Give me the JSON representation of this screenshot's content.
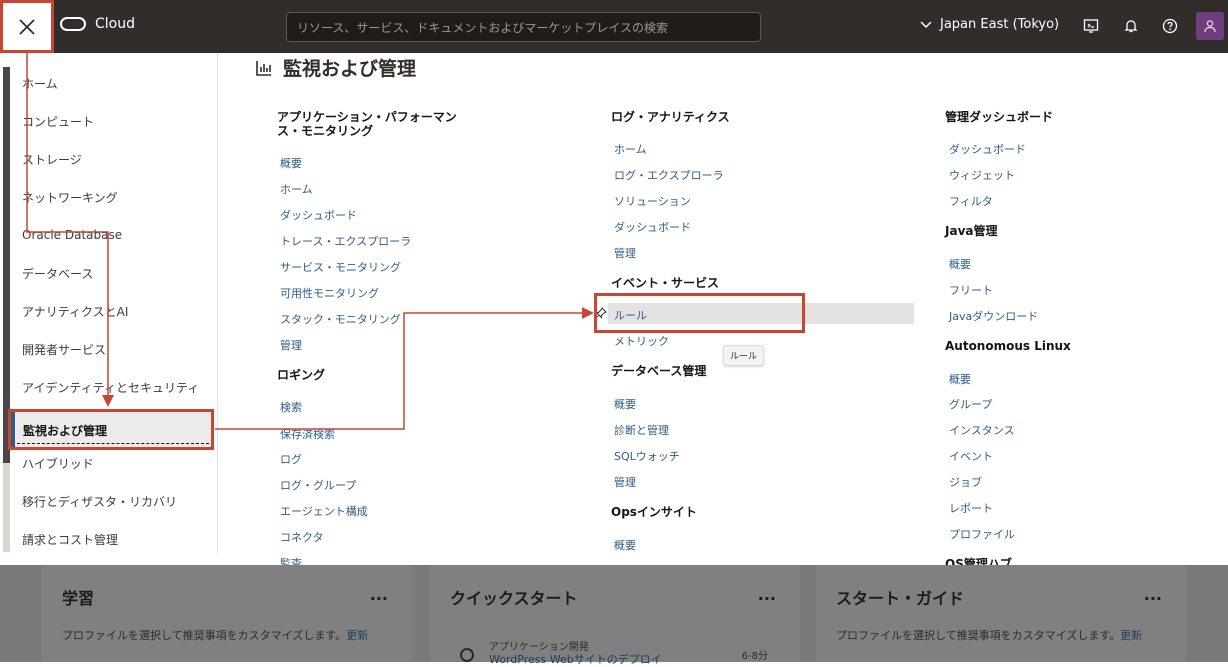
{
  "header": {
    "brand": "Cloud",
    "search_placeholder": "リソース、サービス、ドキュメントおよびマーケットプレイスの検索",
    "region": "Japan East (Tokyo)"
  },
  "nav": {
    "items": [
      "ホーム",
      "コンピュート",
      "ストレージ",
      "ネットワーキング",
      "Oracle Database",
      "データベース",
      "アナリティクスとAI",
      "開発者サービス",
      "アイデンティティとセキュリティ",
      "監視および管理",
      "ハイブリッド",
      "移行とディザスタ・リカバリ",
      "請求とコスト管理"
    ]
  },
  "main": {
    "title": "監視および管理",
    "col1": {
      "apm_title": "アプリケーション・パフォーマンス・モニタリング",
      "apm_title_line1": "アプリケーション・パフォーマン",
      "apm_title_line2": "ス・モニタリング",
      "apm_links": [
        "概要",
        "ホーム",
        "ダッシュボード",
        "トレース・エクスプローラ",
        "サービス・モニタリング",
        "可用性モニタリング",
        "スタック・モニタリング",
        "管理"
      ],
      "logging_title": "ロギング",
      "logging_links": [
        "検索",
        "保存済検索",
        "ログ",
        "ログ・グループ",
        "エージェント構成",
        "コネクタ",
        "監査"
      ]
    },
    "col2": {
      "la_title": "ログ・アナリティクス",
      "la_links": [
        "ホーム",
        "ログ・エクスプローラ",
        "ソリューション",
        "ダッシュボード",
        "管理"
      ],
      "events_title": "イベント・サービス",
      "events_links": [
        "ルール",
        "メトリック"
      ],
      "db_title": "データベース管理",
      "db_links": [
        "概要",
        "診断と管理",
        "SQLウォッチ",
        "管理"
      ],
      "ops_title": "Opsインサイト",
      "ops_links": [
        "概要"
      ]
    },
    "col3": {
      "dash_title": "管理ダッシュボード",
      "dash_links": [
        "ダッシュボード",
        "ウィジェット",
        "フィルタ"
      ],
      "java_title": "Java管理",
      "java_links": [
        "概要",
        "フリート",
        "Javaダウンロード"
      ],
      "al_title": "Autonomous Linux",
      "al_links": [
        "概要",
        "グループ",
        "インスタンス",
        "イベント",
        "ジョブ",
        "レポート",
        "プロファイル"
      ],
      "os_title": "OS管理ハブ"
    },
    "tooltip": "ルール"
  },
  "cards": [
    {
      "title": "学習",
      "more": "...",
      "desc": "プロファイルを選択して推奨事項をカスタマイズします。",
      "link": "更新"
    },
    {
      "title": "クイックスタート",
      "more": "...",
      "sub": "アプリケーション開発",
      "item": "WordPress Webサイトのデプロイ",
      "time": "6-8分"
    },
    {
      "title": "スタート・ガイド",
      "more": "...",
      "desc": "プロファイルを選択して推奨事項をカスタマイズします。",
      "link": "更新"
    }
  ],
  "colors": {
    "accent": "#c74634",
    "link": "#2f5d8a",
    "header_bg": "#312d2a"
  }
}
